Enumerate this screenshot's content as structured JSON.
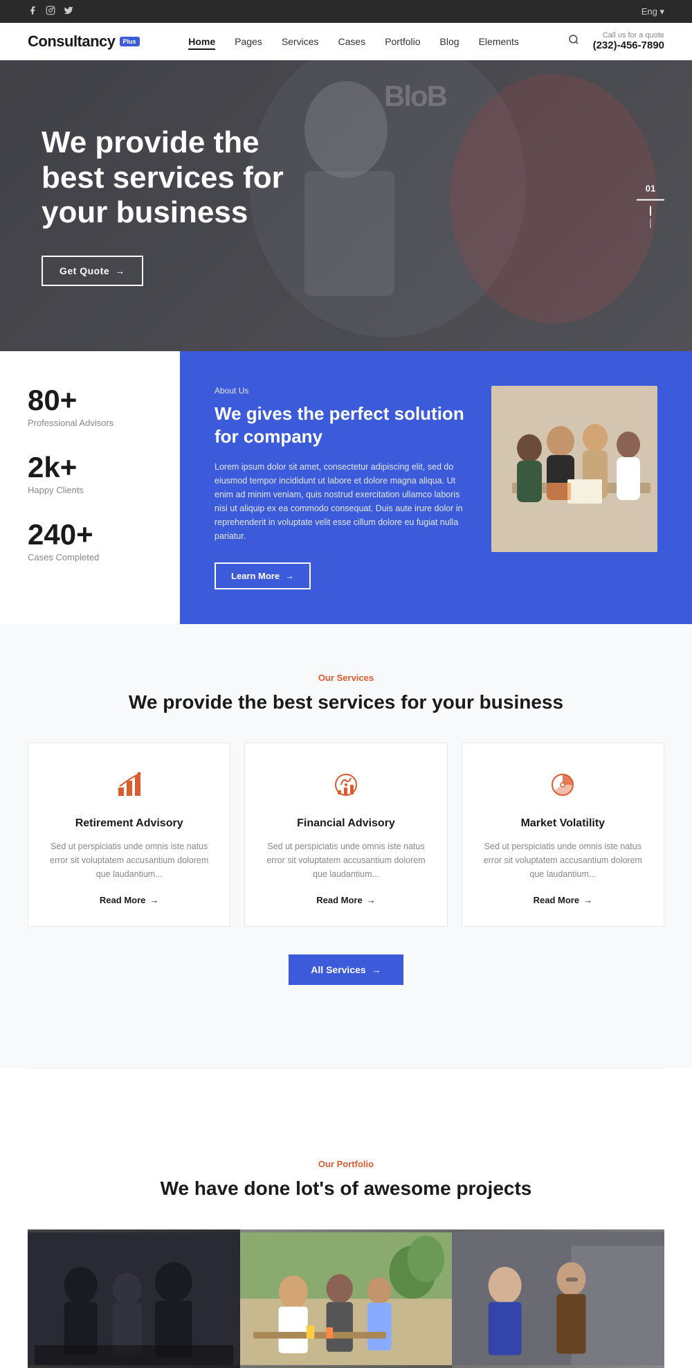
{
  "topbar": {
    "lang": "Eng ▾",
    "social": [
      "f",
      "ig",
      "tw"
    ]
  },
  "header": {
    "logo_text": "Consultancy",
    "logo_badge": "Plus",
    "nav_items": [
      {
        "label": "Home",
        "active": true
      },
      {
        "label": "Pages",
        "active": false
      },
      {
        "label": "Services",
        "active": false
      },
      {
        "label": "Cases",
        "active": false
      },
      {
        "label": "Portfolio",
        "active": false
      },
      {
        "label": "Blog",
        "active": false
      },
      {
        "label": "Elements",
        "active": false
      }
    ],
    "call_label": "Call us for a quote",
    "call_number": "(232)-456-7890"
  },
  "hero": {
    "title": "We provide the best services for your business",
    "btn_label": "Get Quote",
    "slide_num": "01",
    "blob_text": "BloB"
  },
  "stats": {
    "items": [
      {
        "number": "80+",
        "label": "Professional Advisors"
      },
      {
        "number": "2k+",
        "label": "Happy Clients"
      },
      {
        "number": "240+",
        "label": "Cases Completed"
      }
    ]
  },
  "about": {
    "tag": "About Us",
    "title": "We gives the perfect solution for company",
    "body": "Lorem ipsum dolor sit amet, consectetur adipiscing elit, sed do eiusmod tempor incididunt ut labore et dolore magna aliqua. Ut enim ad minim veniam, quis nostrud exercitation ullamco laboris nisi ut aliquip ex ea commodo consequat. Duis aute irure dolor in reprehenderit in voluptate velit esse cillum dolore eu fugiat nulla pariatur.",
    "btn_label": "Learn More",
    "btn_arrow": "→"
  },
  "services": {
    "tag": "Our Services",
    "title": "We provide the best services for your business",
    "cards": [
      {
        "name": "Retirement Advisory",
        "desc": "Sed ut perspiciatis unde omnis iste natus error sit voluptatem accusantium dolorem que laudantium...",
        "read_more": "Read More",
        "icon": "📈"
      },
      {
        "name": "Financial Advisory",
        "desc": "Sed ut perspiciatis unde omnis iste natus error sit voluptatem accusantium dolorem que laudantium...",
        "read_more": "Read More",
        "icon": "💹"
      },
      {
        "name": "Market Volatility",
        "desc": "Sed ut perspiciatis unde omnis iste natus error sit voluptatem accusantium dolorem que laudantium...",
        "read_more": "Read More",
        "icon": "📊"
      }
    ],
    "all_btn": "All Services",
    "all_btn_arrow": "→"
  },
  "portfolio": {
    "tag": "Our Portfolio",
    "title": "We have done lot's of awesome projects"
  }
}
